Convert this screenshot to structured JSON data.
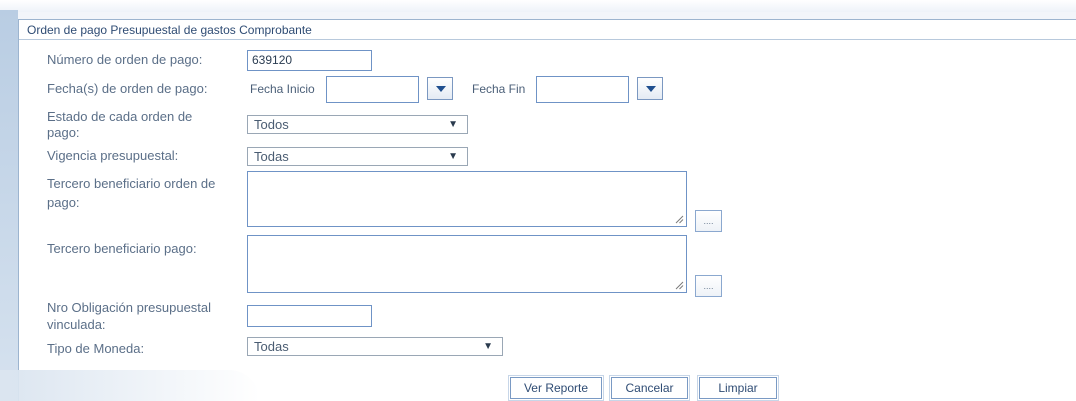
{
  "panel": {
    "title": "Orden de pago Presupuestal de gastos Comprobante"
  },
  "form": {
    "numero_orden": {
      "label": "Número de orden de pago:",
      "value": "639120"
    },
    "fechas": {
      "label": "Fecha(s) de orden de pago:",
      "inicio_label": "Fecha Inicio",
      "inicio_value": "",
      "fin_label": "Fecha Fin",
      "fin_value": ""
    },
    "estado": {
      "label_line1": "Estado de cada orden de",
      "label_line2": "pago:",
      "selected": "Todos"
    },
    "vigencia": {
      "label": "Vigencia presupuestal:",
      "selected": "Todas"
    },
    "tercero_orden": {
      "label_line1": "Tercero beneficiario orden de",
      "label_line2": "pago:",
      "button": "...."
    },
    "tercero_pago": {
      "label": "Tercero beneficiario pago:",
      "button": "...."
    },
    "obligacion": {
      "label_line1": "Nro Obligación presupuestal",
      "label_line2": "vinculada:",
      "value": ""
    },
    "moneda": {
      "label": "Tipo de Moneda:",
      "selected": "Todas"
    },
    "select_arrow": "▼"
  },
  "actions": {
    "ver_reporte": "Ver Reporte",
    "cancelar": "Cancelar",
    "limpiar": "Limpiar"
  },
  "colors": {
    "accent": "#2f4c74",
    "input_border": "#6f93c6",
    "panel_border": "#9cb4cf"
  }
}
